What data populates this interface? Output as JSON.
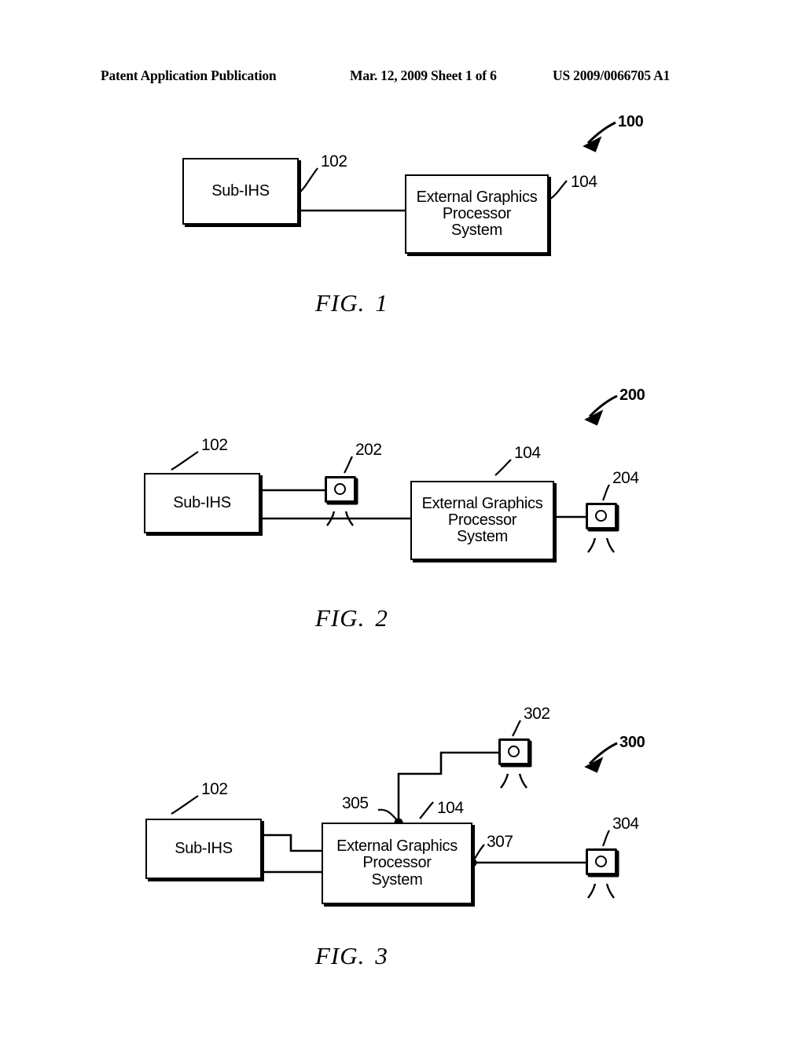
{
  "header": {
    "left": "Patent Application Publication",
    "middle": "Mar. 12, 2009  Sheet 1 of 6",
    "right": "US 2009/0066705 A1"
  },
  "figures": [
    {
      "id": "fig1",
      "caption_label": "FIG.",
      "caption_number": "1",
      "system_ref": "100",
      "boxes": [
        {
          "ref": "102",
          "lines": [
            "Sub-IHS"
          ]
        },
        {
          "ref": "104",
          "lines": [
            "External Graphics",
            "Processor",
            "System"
          ]
        }
      ],
      "monitors": []
    },
    {
      "id": "fig2",
      "caption_label": "FIG.",
      "caption_number": "2",
      "system_ref": "200",
      "boxes": [
        {
          "ref": "102",
          "lines": [
            "Sub-IHS"
          ]
        },
        {
          "ref": "104",
          "lines": [
            "External Graphics",
            "Processor",
            "System"
          ]
        }
      ],
      "monitors": [
        {
          "ref": "202"
        },
        {
          "ref": "204"
        }
      ]
    },
    {
      "id": "fig3",
      "caption_label": "FIG.",
      "caption_number": "3",
      "system_ref": "300",
      "boxes": [
        {
          "ref": "102",
          "lines": [
            "Sub-IHS"
          ]
        },
        {
          "ref": "104",
          "lines": [
            "External Graphics",
            "Processor",
            "System"
          ]
        }
      ],
      "monitors": [
        {
          "ref": "302"
        },
        {
          "ref": "304"
        }
      ],
      "connection_points": [
        {
          "ref": "305"
        },
        {
          "ref": "307"
        }
      ]
    }
  ],
  "labels": {
    "sub_ihs": "Sub-IHS",
    "egps_l1": "External Graphics",
    "egps_l2": "Processor",
    "egps_l3": "System",
    "ref_100": "100",
    "ref_102": "102",
    "ref_104": "104",
    "ref_200": "200",
    "ref_202": "202",
    "ref_204": "204",
    "ref_300": "300",
    "ref_302": "302",
    "ref_304": "304",
    "ref_305": "305",
    "ref_307": "307",
    "fig": "FIG.",
    "n1": "1",
    "n2": "2",
    "n3": "3"
  },
  "colors": {
    "ink": "#000000",
    "paper": "#ffffff"
  }
}
